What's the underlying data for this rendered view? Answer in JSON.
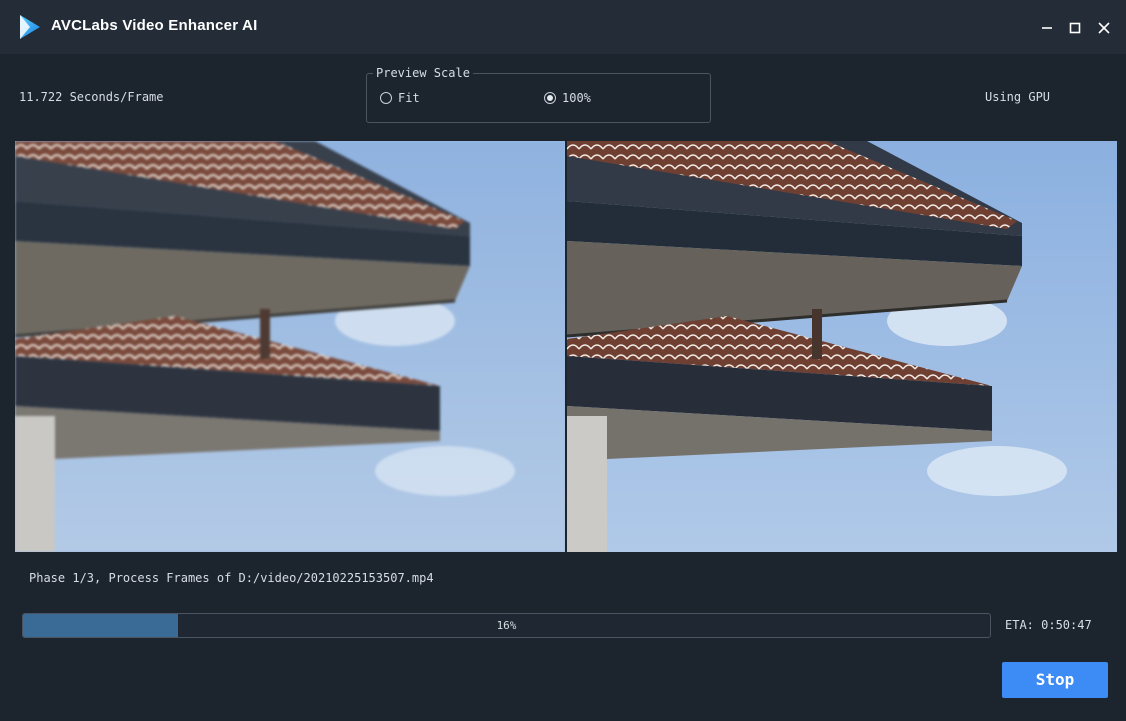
{
  "window": {
    "title": "AVCLabs Video Enhancer AI",
    "logo_icon": "avclabs-play-logo-icon",
    "controls": [
      "minimize-icon",
      "maximize-icon",
      "close-icon"
    ]
  },
  "stats": {
    "speed": "11.722 Seconds/Frame",
    "device": "Using GPU"
  },
  "preview_scale": {
    "legend": "Preview Scale",
    "options": [
      {
        "label": "Fit",
        "selected": false
      },
      {
        "label": "100%",
        "selected": true
      }
    ]
  },
  "previews": {
    "left": "original-preview-image",
    "right": "enhanced-preview-image"
  },
  "progress": {
    "phase": "Phase 1/3, Process Frames of D:/video/20210225153507.mp4",
    "percent": 16,
    "percent_label": "16%",
    "eta": "ETA: 0:50:47"
  },
  "actions": {
    "stop_label": "Stop"
  },
  "colors": {
    "background": "#1c242e",
    "titlebar": "#232c37",
    "accent": "#3d8bf5",
    "progress_fill": "#3a6a96"
  }
}
